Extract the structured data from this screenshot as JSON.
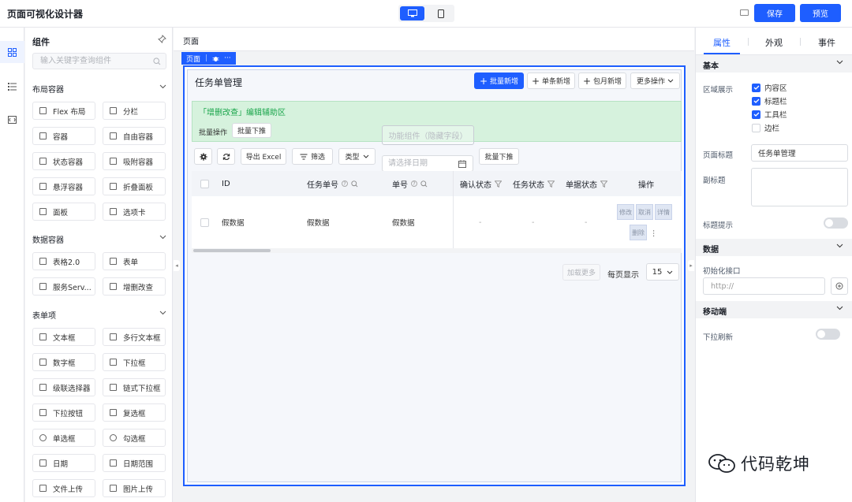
{
  "app": {
    "title": "页面可视化设计器",
    "save_label": "保存",
    "preview_label": "预览"
  },
  "components": {
    "title": "组件",
    "search_placeholder": "输入关键字查询组件",
    "sections": [
      {
        "title": "布局容器",
        "items": [
          "Flex 布局",
          "分栏",
          "容器",
          "自由容器",
          "状态容器",
          "吸附容器",
          "悬浮容器",
          "折叠面板",
          "面板",
          "选项卡"
        ]
      },
      {
        "title": "数据容器",
        "items": [
          "表格2.0",
          "表单",
          "服务Serv...",
          "增删改查"
        ]
      },
      {
        "title": "表单项",
        "items": [
          "文本框",
          "多行文本框",
          "数字框",
          "下拉框",
          "级联选择器",
          "链式下拉框",
          "下拉按钮",
          "复选框",
          "单选框",
          "勾选框",
          "日期",
          "日期范围",
          "文件上传",
          "图片上传"
        ]
      }
    ]
  },
  "canvas": {
    "header_title": "页面",
    "page_tag": {
      "label": "页面",
      "more": "···"
    },
    "crud": {
      "title": "任务单管理",
      "toolbar": [
        "批量新增",
        "单条新增",
        "包月新增",
        "更多操作"
      ],
      "aux_title": "「增删改查」编辑辅助区",
      "aux_batch_label": "批量操作",
      "aux_batch_button": "批量下推",
      "hidden_component": "功能组件（隐藏字段）",
      "filter_bar": {
        "export": "导出 Excel",
        "filter": "筛选",
        "type": "类型",
        "date_placeholder": "请选择日期",
        "batch_push": "批量下推"
      },
      "columns": [
        "ID",
        "任务单号",
        "单号",
        "确认状态",
        "任务状态",
        "单据状态",
        "操作"
      ],
      "rows": [
        {
          "id": "假数据",
          "task_no": "假数据",
          "no": "假数据",
          "confirm": "-",
          "task_status": "-",
          "doc_status": "-"
        }
      ],
      "op_fragments": [
        "修改",
        "取消",
        "详情",
        "删除"
      ],
      "pager": {
        "load_more": "加载更多",
        "per_page_label": "每页显示",
        "per_page": "15"
      }
    }
  },
  "props": {
    "tabs": [
      "属性",
      "外观",
      "事件"
    ],
    "basic": {
      "title": "基本",
      "region_label": "区域展示",
      "regions": [
        {
          "label": "内容区",
          "checked": true
        },
        {
          "label": "标题栏",
          "checked": true
        },
        {
          "label": "工具栏",
          "checked": true
        },
        {
          "label": "边栏",
          "checked": false
        }
      ],
      "page_title_label": "页面标题",
      "page_title_value": "任务单管理",
      "subtitle_label": "副标题",
      "title_hint_label": "标题提示"
    },
    "data": {
      "title": "数据",
      "init_api_label": "初始化接口",
      "init_api_placeholder": "http://"
    },
    "mobile": {
      "title": "移动端",
      "pull_refresh_label": "下拉刷新"
    }
  },
  "watermark": {
    "text": "代码乾坤"
  },
  "colors": {
    "accent": "#1e5eff",
    "aux_bg": "#d6f2dd",
    "aux_text": "#1aa54b"
  }
}
